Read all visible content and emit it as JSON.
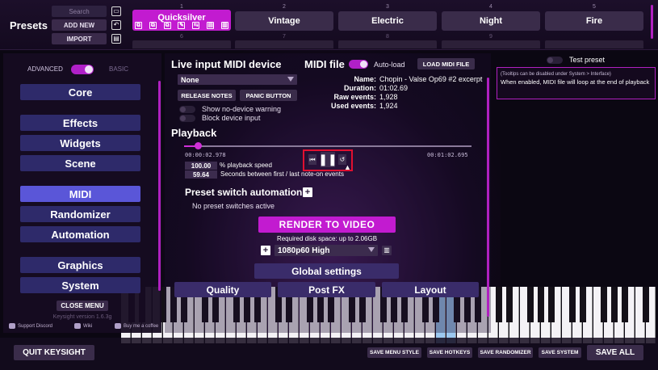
{
  "colors": {
    "accent": "#c21bd0",
    "nav_active": "#5a56d8",
    "nav_idle": "#2e2a6a",
    "highlight_box": "#e01030"
  },
  "presets": {
    "title": "Presets",
    "search_placeholder": "Search",
    "add_new": "ADD NEW",
    "import": "IMPORT",
    "slots": [
      {
        "num": "1",
        "label": "Quicksilver"
      },
      {
        "num": "2",
        "label": "Vintage"
      },
      {
        "num": "3",
        "label": "Electric"
      },
      {
        "num": "4",
        "label": "Night"
      },
      {
        "num": "5",
        "label": "Fire"
      }
    ],
    "slots_row2": [
      "6",
      "7",
      "8",
      "9"
    ]
  },
  "menu": {
    "advanced": "ADVANCED",
    "basic": "BASIC",
    "items": [
      "Core",
      "Effects",
      "Widgets",
      "Scene",
      "MIDI",
      "Randomizer",
      "Automation",
      "Graphics",
      "System"
    ],
    "active": "MIDI",
    "close_menu": "CLOSE MENU",
    "version": "Keysight version 1.6.3g",
    "links": [
      "Support Discord",
      "Wiki",
      "Buy me a coffee"
    ]
  },
  "midi_device": {
    "title": "Live input MIDI device",
    "selected": "None",
    "release_notes": "RELEASE NOTES",
    "panic_button": "PANIC BUTTON",
    "show_no_device_warning": "Show no-device warning",
    "block_device_input": "Block device input"
  },
  "midi_file": {
    "title": "MIDI file",
    "auto_load": "Auto-load",
    "load_button": "LOAD MIDI FILE",
    "info": [
      {
        "key": "Name:",
        "value": "Chopin - Valse Op69 #2 excerpt"
      },
      {
        "key": "Duration:",
        "value": "01:02.69"
      },
      {
        "key": "Raw events:",
        "value": "1,928"
      },
      {
        "key": "Used events:",
        "value": "1,924"
      }
    ]
  },
  "playback": {
    "title": "Playback",
    "current_time": "00:00:02.978",
    "total_time": "00:01:02.695",
    "position_fraction": 0.047,
    "speed_value": "100.00",
    "speed_label": "% playback speed",
    "gap_value": "59.64",
    "gap_label": "Seconds between first / last note-on events"
  },
  "automation": {
    "title": "Preset switch automation",
    "status": "No preset switches active"
  },
  "render": {
    "button": "RENDER TO VIDEO",
    "disk": "Required disk space: up to 2.06GB",
    "resolution": "1080p60 High"
  },
  "global": {
    "title": "Global settings",
    "tabs": [
      "Quality",
      "Post FX",
      "Layout"
    ]
  },
  "tooltip": {
    "test_preset": "Test preset",
    "note": "(Tooltips can be disabled under System > Interface)",
    "text": "When enabled, MIDI file will loop at the end of playback"
  },
  "bottom": {
    "quit": "QUIT KEYSIGHT",
    "saves": [
      "SAVE MENU STYLE",
      "SAVE HOTKEYS",
      "SAVE RANDOMIZER",
      "SAVE SYSTEM"
    ],
    "save_all": "SAVE ALL"
  }
}
